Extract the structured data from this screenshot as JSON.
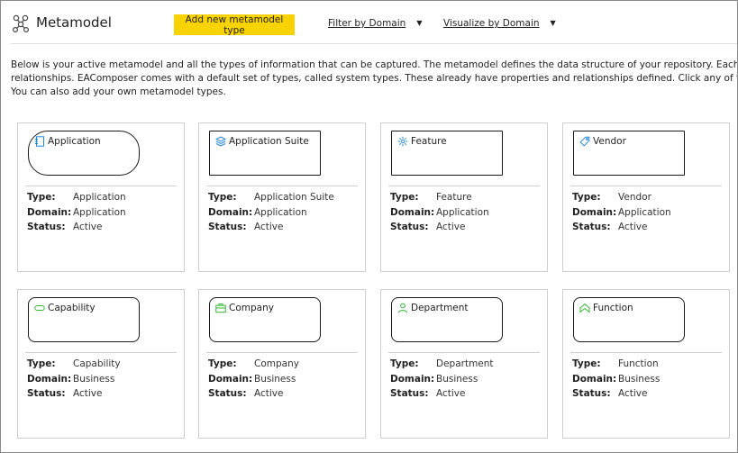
{
  "header": {
    "title": "Metamodel",
    "add_button": "Add new metamodel type",
    "filter_dropdown": "Filter by Domain",
    "visualize_dropdown": "Visualize by Domain"
  },
  "intro": {
    "line1": "Below is your active metamodel and all the types of information that can be captured.  The metamodel defines the data structure of your repository. Each informati",
    "line2": "relationships.  EAComposer comes with a default set of types, called system types. These already have properties and relationships defined.  Click any of the types t",
    "line3": "You can also add your own metamodel types."
  },
  "labels": {
    "type": "Type:",
    "domain": "Domain:",
    "status": "Status:"
  },
  "colors": {
    "accent": "#f9d300",
    "icon_blue": "#1e88e5",
    "icon_green": "#2eb82e"
  },
  "cards": [
    {
      "name": "Application",
      "type": "Application",
      "domain": "Application",
      "status": "Active",
      "icon": "application-icon"
    },
    {
      "name": "Application Suite",
      "type": "Application Suite",
      "domain": "Application",
      "status": "Active",
      "icon": "layers-icon"
    },
    {
      "name": "Feature",
      "type": "Feature",
      "domain": "Application",
      "status": "Active",
      "icon": "gear-icon"
    },
    {
      "name": "Vendor",
      "type": "Vendor",
      "domain": "Application",
      "status": "Active",
      "icon": "tag-icon"
    },
    {
      "name": "Capability",
      "type": "Capability",
      "domain": "Business",
      "status": "Active",
      "icon": "capability-icon"
    },
    {
      "name": "Company",
      "type": "Company",
      "domain": "Business",
      "status": "Active",
      "icon": "briefcase-icon"
    },
    {
      "name": "Department",
      "type": "Department",
      "domain": "Business",
      "status": "Active",
      "icon": "person-icon"
    },
    {
      "name": "Function",
      "type": "Function",
      "domain": "Business",
      "status": "Active",
      "icon": "chevron-up-icon"
    }
  ]
}
